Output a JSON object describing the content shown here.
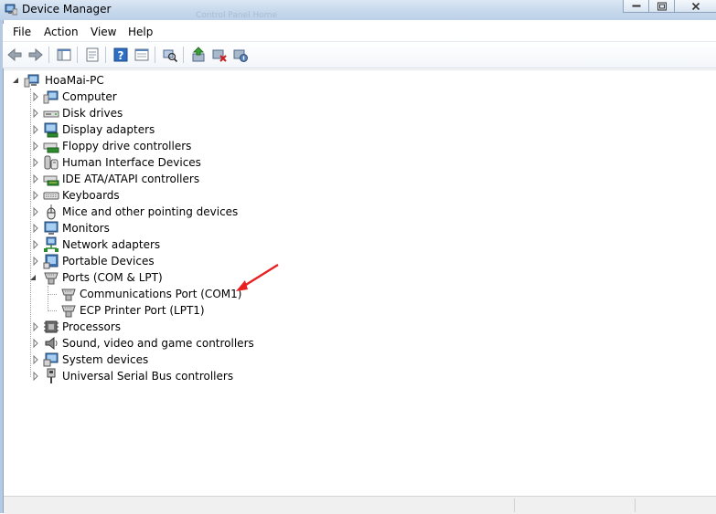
{
  "window": {
    "title": "Device Manager",
    "ghost_text": "Control Panel Home"
  },
  "menu": [
    {
      "label": "File"
    },
    {
      "label": "Action"
    },
    {
      "label": "View"
    },
    {
      "label": "Help"
    }
  ],
  "toolbar": {
    "buttons": [
      "back-icon",
      "forward-icon",
      "show-hide-console-tree-icon",
      "properties-icon",
      "help-icon",
      "show-view-icon",
      "scan-hardware-icon",
      "update-driver-icon",
      "uninstall-icon",
      "disable-device-icon"
    ]
  },
  "tree": {
    "root": "HoaMai-PC",
    "categories": [
      {
        "label": "Computer",
        "icon": "computer-icon"
      },
      {
        "label": "Disk drives",
        "icon": "disk-drive-icon"
      },
      {
        "label": "Display adapters",
        "icon": "display-adapter-icon"
      },
      {
        "label": "Floppy drive controllers",
        "icon": "floppy-controller-icon"
      },
      {
        "label": "Human Interface Devices",
        "icon": "hid-icon"
      },
      {
        "label": "IDE ATA/ATAPI controllers",
        "icon": "ide-controller-icon"
      },
      {
        "label": "Keyboards",
        "icon": "keyboard-icon"
      },
      {
        "label": "Mice and other pointing devices",
        "icon": "mouse-icon"
      },
      {
        "label": "Monitors",
        "icon": "monitor-icon"
      },
      {
        "label": "Network adapters",
        "icon": "network-adapter-icon"
      },
      {
        "label": "Portable Devices",
        "icon": "portable-device-icon"
      },
      {
        "label": "Ports (COM & LPT)",
        "icon": "port-icon",
        "expanded": true,
        "children": [
          {
            "label": "Communications Port (COM1)",
            "icon": "port-icon"
          },
          {
            "label": "ECP Printer Port (LPT1)",
            "icon": "port-icon"
          }
        ]
      },
      {
        "label": "Processors",
        "icon": "processor-icon"
      },
      {
        "label": "Sound, video and game controllers",
        "icon": "sound-icon"
      },
      {
        "label": "System devices",
        "icon": "system-device-icon"
      },
      {
        "label": "Universal Serial Bus controllers",
        "icon": "usb-icon"
      }
    ]
  },
  "annotation": {
    "color": "#e8201f"
  }
}
